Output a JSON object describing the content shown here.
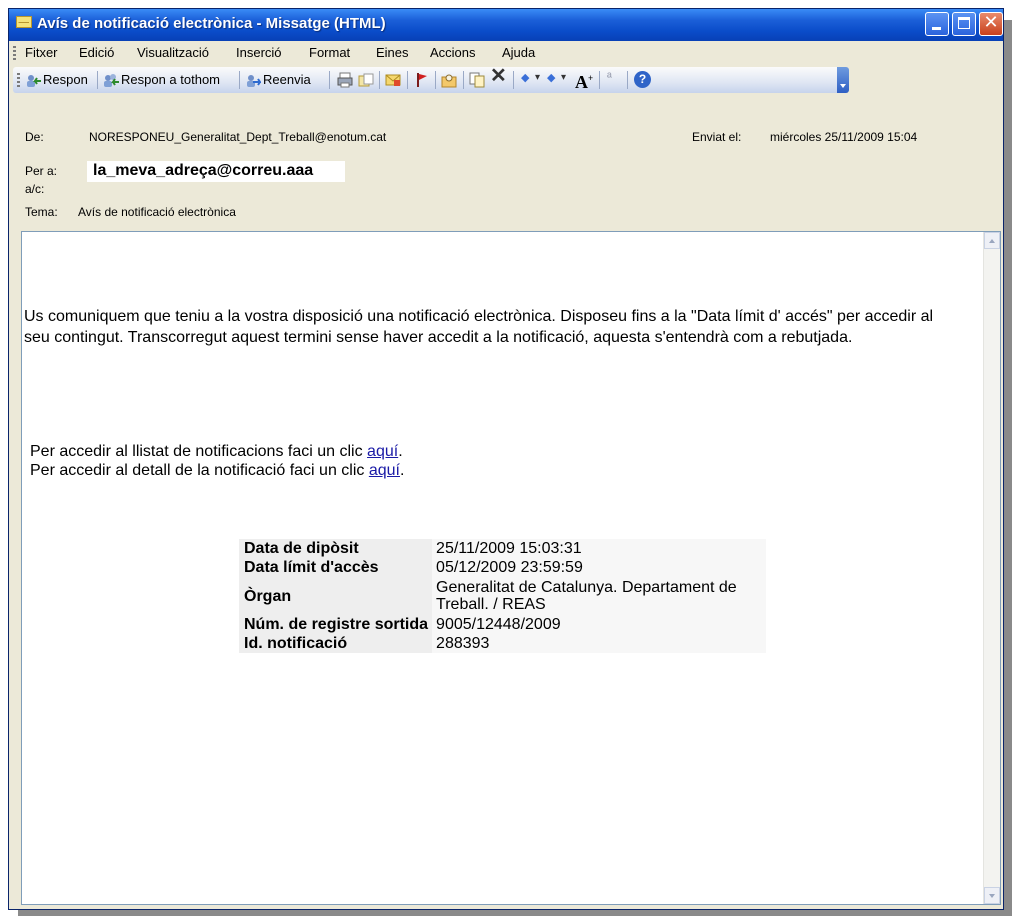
{
  "window": {
    "title": "Avís de notificació electrònica - Missatge (HTML)",
    "close_glyph": "✕"
  },
  "menu": {
    "items": [
      "Fitxer",
      "Edició",
      "Visualització",
      "Inserció",
      "Format",
      "Eines",
      "Accions",
      "Ajuda"
    ]
  },
  "toolbar": {
    "reply_label": "Respon",
    "reply_all_label": "Respon a tothom",
    "forward_label": "Reenvia",
    "delete_glyph": "✕",
    "prev_glyph": "◆",
    "next_glyph": "◆",
    "dropdown_glyph": "▾",
    "font_size_glyph": "A",
    "font_size_sup": "+",
    "translate_glyph": "ª",
    "help_glyph": "?"
  },
  "header": {
    "from_label": "De:",
    "from_value": "NORESPONEU_Generalitat_Dept_Treball@enotum.cat",
    "sent_label": "Enviat el:",
    "sent_value": "miércoles 25/11/2009 15:04",
    "to_label": "Per a:",
    "to_value": "la_meva_adreça@correu.aaa",
    "cc_label": "a/c:",
    "subject_label": "Tema:",
    "subject_value": "Avís de notificació electrònica"
  },
  "body": {
    "paragraph": "Us comuniquem que teniu a la vostra disposició una notificació electrònica. Disposeu fins a la \"Data límit d' accés\" per accedir al seu contingut. Transcorregut aquest termini sense haver accedit a la notificació, aquesta s'entendrà com a rebutjada.",
    "list_text": "Per accedir al llistat de notificacions faci un clic",
    "detail_text": "Per accedir al detall de la notificació faci un clic",
    "link_label": "aquí",
    "link_suffix": "."
  },
  "details": {
    "rows": [
      {
        "key": "Data de dipòsit",
        "value": "25/11/2009 15:03:31"
      },
      {
        "key": "Data límit d'accès",
        "value": "05/12/2009 23:59:59"
      },
      {
        "key": "Òrgan",
        "value": "Generalitat de Catalunya. Departament de Treball. / REAS"
      },
      {
        "key": "Núm. de registre sortida",
        "value": "9005/12448/2009"
      },
      {
        "key": "Id. notificació",
        "value": "288393"
      }
    ]
  },
  "colors": {
    "titlebar": "#0a4cc9",
    "chrome": "#ece9d8",
    "link": "#1a1aa6"
  }
}
